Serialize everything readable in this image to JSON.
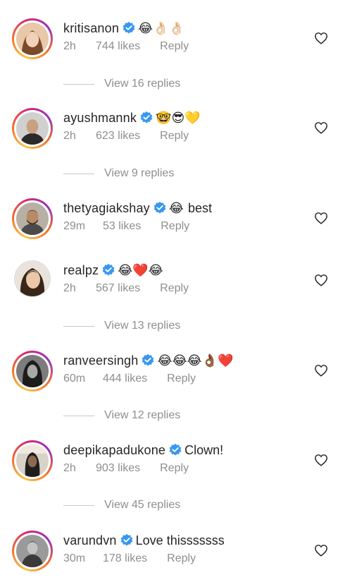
{
  "comments": [
    {
      "username": "kritisanon",
      "emoji": "😂👌🏻👌🏻",
      "text": "",
      "time": "2h",
      "likes": "744 likes",
      "reply": "Reply",
      "view_replies": "View 16 replies",
      "story_ring": true
    },
    {
      "username": "ayushmannk",
      "emoji": "🤓😎💛",
      "text": "",
      "time": "2h",
      "likes": "623 likes",
      "reply": "Reply",
      "view_replies": "View 9 replies",
      "story_ring": true
    },
    {
      "username": "thetyagiakshay",
      "emoji": "😂",
      "text": "best",
      "time": "29m",
      "likes": "53 likes",
      "reply": "Reply",
      "view_replies": "",
      "story_ring": true
    },
    {
      "username": "realpz",
      "emoji": "😂❤️😂",
      "text": "",
      "time": "2h",
      "likes": "567 likes",
      "reply": "Reply",
      "view_replies": "View 13 replies",
      "story_ring": false
    },
    {
      "username": "ranveersingh",
      "emoji": "😂😂😂👌🏾❤️",
      "text": "",
      "time": "60m",
      "likes": "444 likes",
      "reply": "Reply",
      "view_replies": "View 12 replies",
      "story_ring": true
    },
    {
      "username": "deepikapadukone",
      "emoji": "",
      "text": "Clown!",
      "time": "2h",
      "likes": "903 likes",
      "reply": "Reply",
      "view_replies": "View 45 replies",
      "story_ring": true
    },
    {
      "username": "varundvn",
      "emoji": "",
      "text": "Love thisssssss",
      "time": "30m",
      "likes": "178 likes",
      "reply": "Reply",
      "view_replies": "",
      "story_ring": true
    }
  ],
  "colors": {
    "text": "#262626",
    "secondary": "#8e8e8e",
    "verified": "#3897f0",
    "divider": "#c7c7c7"
  },
  "icons": {
    "verified": "verified-badge-icon",
    "like": "heart-outline-icon"
  }
}
